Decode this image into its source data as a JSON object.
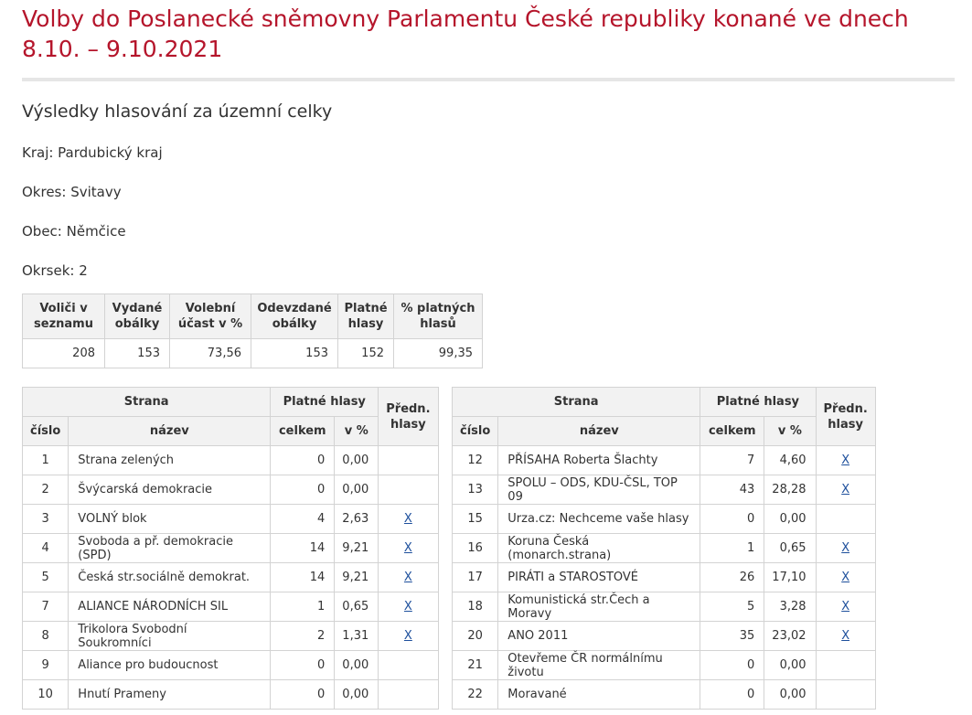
{
  "title": "Volby do Poslanecké sněmovny Parlamentu České republiky konané ve dnech 8.10. – 9.10.2021",
  "subtitle": "Výsledky hlasování za územní celky",
  "kraj": "Kraj: Pardubický kraj",
  "okres": "Okres: Svitavy",
  "obec": "Obec: Němčice",
  "okrsek": "Okrsek: 2",
  "summary": {
    "headers": [
      "Voliči v seznamu",
      "Vydané obálky",
      "Volební účast v %",
      "Odevzdané obálky",
      "Platné hlasy",
      "% platných hlasů"
    ],
    "values": [
      "208",
      "153",
      "73,56",
      "153",
      "152",
      "99,35"
    ]
  },
  "parties_headers": {
    "strana": "Strana",
    "platne_hlasy": "Platné hlasy",
    "predn_hlasy": "Předn. hlasy",
    "cislo": "číslo",
    "nazev": "název",
    "celkem": "celkem",
    "v_procent": "v %"
  },
  "parties_left": [
    {
      "cislo": "1",
      "nazev": "Strana zelených",
      "celkem": "0",
      "pct": "0,00",
      "link": ""
    },
    {
      "cislo": "2",
      "nazev": "Švýcarská demokracie",
      "celkem": "0",
      "pct": "0,00",
      "link": ""
    },
    {
      "cislo": "3",
      "nazev": "VOLNÝ blok",
      "celkem": "4",
      "pct": "2,63",
      "link": "X"
    },
    {
      "cislo": "4",
      "nazev": "Svoboda a př. demokracie (SPD)",
      "celkem": "14",
      "pct": "9,21",
      "link": "X"
    },
    {
      "cislo": "5",
      "nazev": "Česká str.sociálně demokrat.",
      "celkem": "14",
      "pct": "9,21",
      "link": "X"
    },
    {
      "cislo": "7",
      "nazev": "ALIANCE NÁRODNÍCH SIL",
      "celkem": "1",
      "pct": "0,65",
      "link": "X"
    },
    {
      "cislo": "8",
      "nazev": "Trikolora Svobodní Soukromníci",
      "celkem": "2",
      "pct": "1,31",
      "link": "X"
    },
    {
      "cislo": "9",
      "nazev": "Aliance pro budoucnost",
      "celkem": "0",
      "pct": "0,00",
      "link": ""
    },
    {
      "cislo": "10",
      "nazev": "Hnutí Prameny",
      "celkem": "0",
      "pct": "0,00",
      "link": ""
    }
  ],
  "parties_right": [
    {
      "cislo": "12",
      "nazev": "PŘÍSAHA Roberta Šlachty",
      "celkem": "7",
      "pct": "4,60",
      "link": "X"
    },
    {
      "cislo": "13",
      "nazev": "SPOLU – ODS, KDU-ČSL, TOP 09",
      "celkem": "43",
      "pct": "28,28",
      "link": "X"
    },
    {
      "cislo": "15",
      "nazev": "Urza.cz: Nechceme vaše hlasy",
      "celkem": "0",
      "pct": "0,00",
      "link": ""
    },
    {
      "cislo": "16",
      "nazev": "Koruna Česká (monarch.strana)",
      "celkem": "1",
      "pct": "0,65",
      "link": "X"
    },
    {
      "cislo": "17",
      "nazev": "PIRÁTI a STAROSTOVÉ",
      "celkem": "26",
      "pct": "17,10",
      "link": "X"
    },
    {
      "cislo": "18",
      "nazev": "Komunistická str.Čech a Moravy",
      "celkem": "5",
      "pct": "3,28",
      "link": "X"
    },
    {
      "cislo": "20",
      "nazev": "ANO 2011",
      "celkem": "35",
      "pct": "23,02",
      "link": "X"
    },
    {
      "cislo": "21",
      "nazev": "Otevřeme ČR normálnímu životu",
      "celkem": "0",
      "pct": "0,00",
      "link": ""
    },
    {
      "cislo": "22",
      "nazev": "Moravané",
      "celkem": "0",
      "pct": "0,00",
      "link": ""
    }
  ]
}
